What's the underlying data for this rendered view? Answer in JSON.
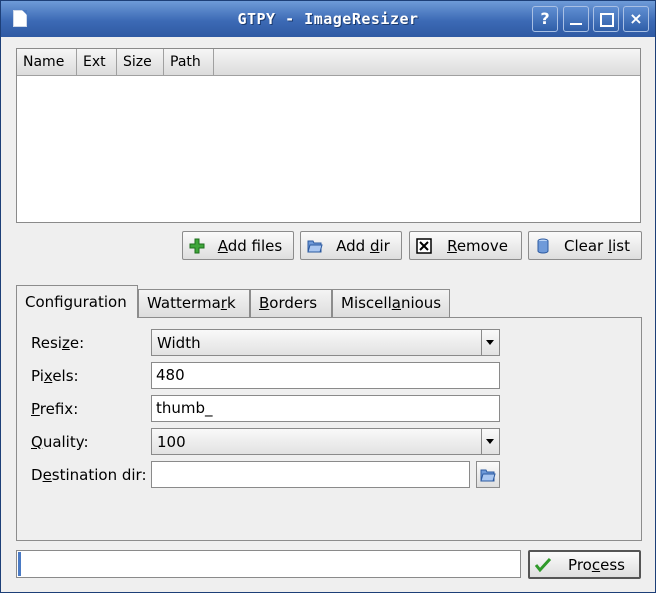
{
  "window": {
    "title": "GTPY - ImageResizer"
  },
  "titlebar": {
    "help": "?",
    "minimize": "_",
    "maximize": "□",
    "close": "×"
  },
  "filelist": {
    "columns": [
      "Name",
      "Ext",
      "Size",
      "Path"
    ],
    "rows": []
  },
  "buttons": {
    "add_files": {
      "pre": "",
      "u": "A",
      "post": "dd files"
    },
    "add_dir": {
      "pre": "Add ",
      "u": "d",
      "post": "ir"
    },
    "remove": {
      "pre": "",
      "u": "R",
      "post": "emove"
    },
    "clear_list": {
      "pre": "Clear ",
      "u": "l",
      "post": "ist"
    },
    "process": {
      "pre": "Pro",
      "u": "c",
      "post": "ess"
    }
  },
  "tabs": {
    "configuration": {
      "pre": "Configuration",
      "u": "",
      "post": ""
    },
    "wattermark": {
      "pre": "Watterma",
      "u": "r",
      "post": "k"
    },
    "borders": {
      "pre": "",
      "u": "B",
      "post": "orders"
    },
    "miscellanious": {
      "pre": "Miscell",
      "u": "a",
      "post": "nious"
    }
  },
  "config": {
    "resize_label": {
      "pre": "Resi",
      "u": "z",
      "post": "e:"
    },
    "resize_value": "Width",
    "pixels_label": {
      "pre": "Pi",
      "u": "x",
      "post": "els:"
    },
    "pixels_value": "480",
    "prefix_label": {
      "pre": "",
      "u": "P",
      "post": "refix:"
    },
    "prefix_value": "thumb_",
    "quality_label": {
      "pre": "",
      "u": "Q",
      "post": "uality:"
    },
    "quality_value": "100",
    "destination_label": {
      "pre": "D",
      "u": "e",
      "post": "stination dir:"
    },
    "destination_value": ""
  },
  "statusbar": {
    "text": ""
  }
}
